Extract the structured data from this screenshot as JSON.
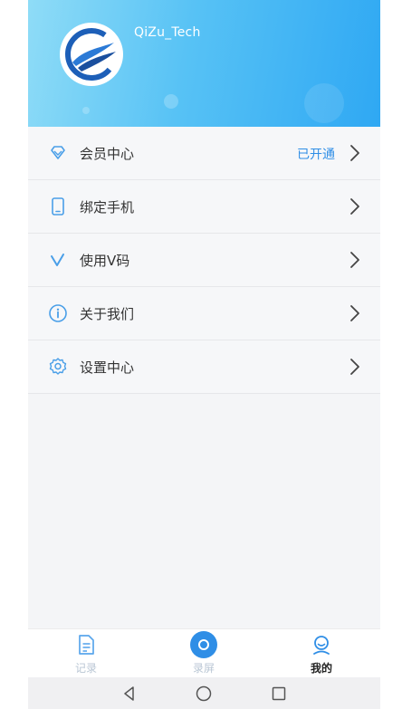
{
  "profile": {
    "username": "QiZu_Tech",
    "avatar_icon": "qizu-logo-icon"
  },
  "menu": {
    "items": [
      {
        "id": "member",
        "label": "会员中心",
        "icon": "diamond-icon",
        "value": "已开通"
      },
      {
        "id": "bind-phone",
        "label": "绑定手机",
        "icon": "phone-icon",
        "value": ""
      },
      {
        "id": "v-code",
        "label": "使用V码",
        "icon": "v-icon",
        "value": ""
      },
      {
        "id": "about",
        "label": "关于我们",
        "icon": "info-icon",
        "value": ""
      },
      {
        "id": "settings",
        "label": "设置中心",
        "icon": "gear-icon",
        "value": ""
      }
    ]
  },
  "tabbar": {
    "tabs": [
      {
        "label": "记录",
        "icon": "document-icon",
        "active": false
      },
      {
        "label": "录屏",
        "icon": "record-icon",
        "active": false
      },
      {
        "label": "我的",
        "icon": "profile-icon",
        "active": true
      }
    ]
  },
  "colors": {
    "accent": "#2f8ee6",
    "header_start": "#8fdcf7",
    "header_end": "#2fa8f3",
    "icon_blue": "#4a9fe8"
  }
}
